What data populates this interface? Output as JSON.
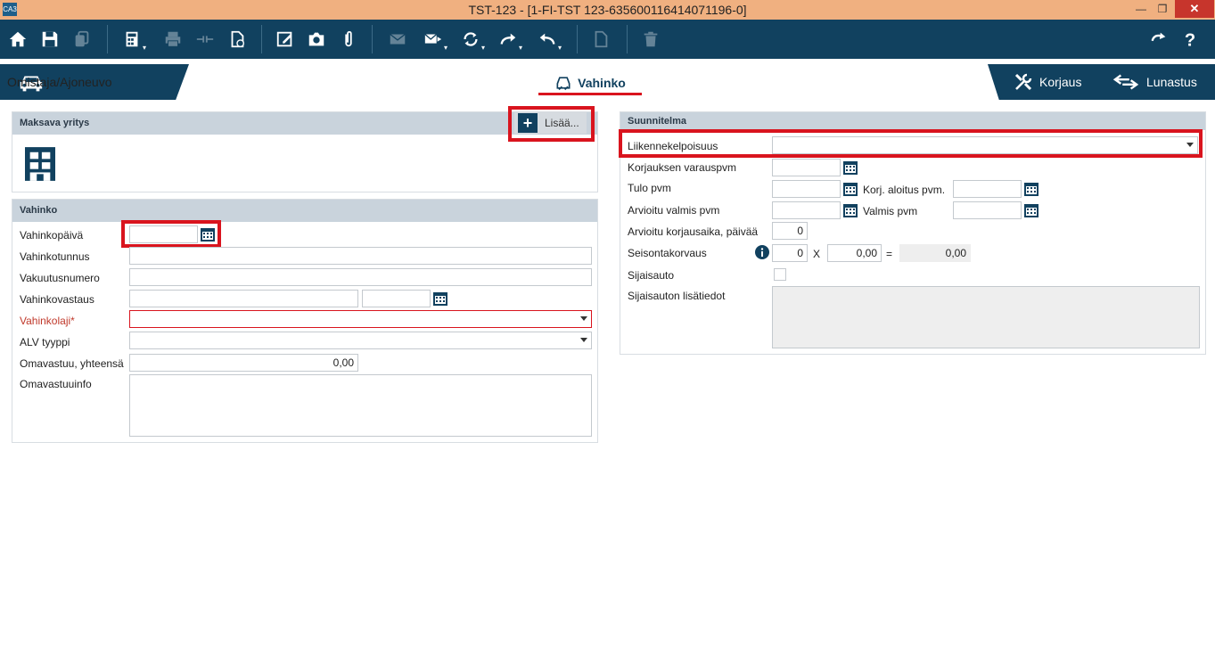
{
  "window": {
    "title": "TST-123 - [1-FI-TST 123-635600116414071196-0]",
    "app_icon_text": "CA3"
  },
  "toolbar": {
    "icons": [
      "home-icon",
      "save-icon",
      "copy-icon",
      "calculator-icon",
      "print-icon",
      "merge-icon",
      "document-check-icon",
      "edit-icon",
      "camera-icon",
      "paperclip-icon",
      "mail-icon",
      "send-icon",
      "sync-icon",
      "forward-icon",
      "reply-icon",
      "document-icon",
      "trash-icon",
      "redo-icon",
      "help-icon"
    ]
  },
  "tabs": {
    "owner": "Omistaja/Ajoneuvo",
    "damage": "Vahinko",
    "repair": "Korjaus",
    "redemption": "Lunastus"
  },
  "payer": {
    "header": "Maksava yritys",
    "add_label": "Lisää..."
  },
  "damage": {
    "header": "Vahinko",
    "labels": {
      "date": "Vahinkopäivä",
      "id": "Vahinkotunnus",
      "insurance_no": "Vakuutusnumero",
      "handler": "Vahinkovastaus",
      "type": "Vahinkolaji*",
      "vat": "ALV tyyppi",
      "deductible": "Omavastuu, yhteensä",
      "deductible_info": "Omavastuuinfo"
    },
    "values": {
      "date": "",
      "id": "",
      "insurance_no": "",
      "handler": "",
      "handler_date": "",
      "type": "",
      "vat": "",
      "deductible": "0,00"
    }
  },
  "plan": {
    "header": "Suunnitelma",
    "labels": {
      "roadworthiness": "Liikennekelpoisuus",
      "booking_date": "Korjauksen varauspvm",
      "arrival_date": "Tulo pvm",
      "repair_start": "Korj. aloitus pvm.",
      "estimated_ready": "Arvioitu valmis pvm",
      "ready_date": "Valmis pvm",
      "estimated_days": "Arvioitu korjausaika, päivää",
      "downtime": "Seisontakorvaus",
      "times": "X",
      "equals": "=",
      "replacement_car": "Sijaisauto",
      "replacement_info": "Sijaisauton lisätiedot"
    },
    "values": {
      "roadworthiness": "",
      "estimated_days": "0",
      "downtime_days": "0",
      "downtime_rate": "0,00",
      "downtime_total": "0,00",
      "replacement_car_checked": false
    }
  }
}
